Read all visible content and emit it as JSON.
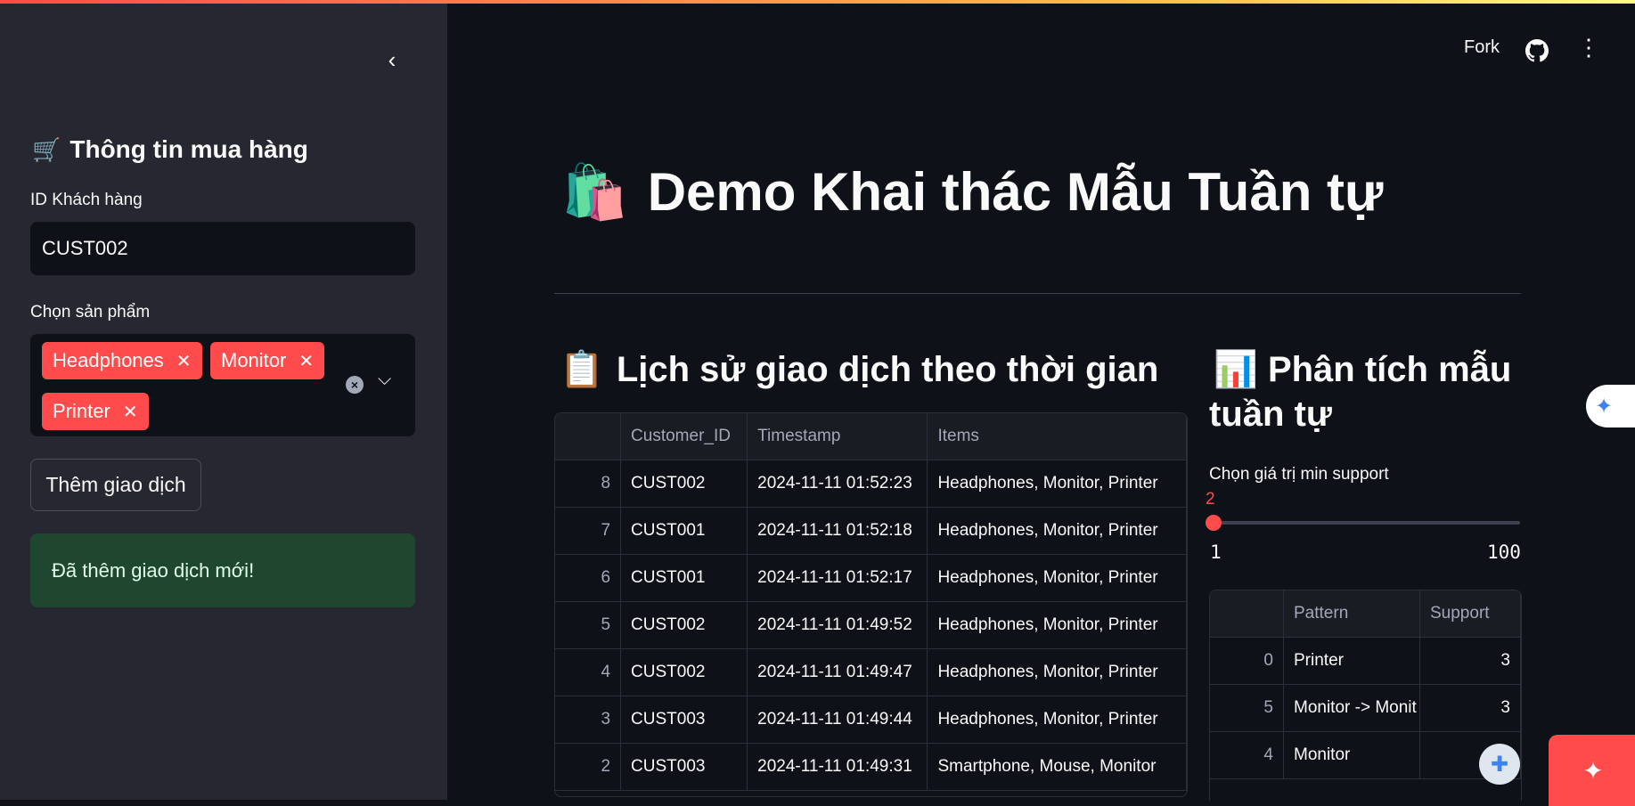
{
  "header": {
    "fork_label": "Fork",
    "github_icon": "github-icon",
    "menu_icon": "kebab-menu-icon"
  },
  "sidebar": {
    "collapse_icon": "chevron-left-icon",
    "title_icon": "🛒",
    "title": "Thông tin mua hàng",
    "customer_id_label": "ID Khách hàng",
    "customer_id_value": "CUST002",
    "products_label": "Chọn sản phẩm",
    "selected_products": [
      "Headphones",
      "Monitor",
      "Printer"
    ],
    "add_button": "Thêm giao dịch",
    "success_message": "Đã thêm giao dịch mới!"
  },
  "main": {
    "title_icon": "🛍️",
    "title": "Demo Khai thác Mẫu Tuần tự",
    "history": {
      "icon": "📋",
      "heading": "Lịch sử giao dịch theo thời gian",
      "columns": [
        "",
        "Customer_ID",
        "Timestamp",
        "Items"
      ],
      "rows": [
        [
          "8",
          "CUST002",
          "2024-11-11 01:52:23",
          "Headphones, Monitor, Printer"
        ],
        [
          "7",
          "CUST001",
          "2024-11-11 01:52:18",
          "Headphones, Monitor, Printer"
        ],
        [
          "6",
          "CUST001",
          "2024-11-11 01:52:17",
          "Headphones, Monitor, Printer"
        ],
        [
          "5",
          "CUST002",
          "2024-11-11 01:49:52",
          "Headphones, Monitor, Printer"
        ],
        [
          "4",
          "CUST002",
          "2024-11-11 01:49:47",
          "Headphones, Monitor, Printer"
        ],
        [
          "3",
          "CUST003",
          "2024-11-11 01:49:44",
          "Headphones, Monitor, Printer"
        ],
        [
          "2",
          "CUST003",
          "2024-11-11 01:49:31",
          "Smartphone, Mouse, Monitor"
        ]
      ]
    },
    "analysis": {
      "icon": "📊",
      "heading_line1": "Phân tích mẫu",
      "heading_line2": "tuần tự",
      "slider_label": "Chọn giá trị min support",
      "slider_value": "2",
      "slider_min": "1",
      "slider_max": "100",
      "slider_fraction": 0.0101,
      "columns": [
        "",
        "Pattern",
        "Support"
      ],
      "rows": [
        [
          "0",
          "Printer",
          "3"
        ],
        [
          "5",
          "Monitor -> Monit",
          "3"
        ],
        [
          "4",
          "Monitor",
          ""
        ]
      ]
    }
  },
  "colors": {
    "accent": "#ff4b4b",
    "sidebar_bg": "#262730",
    "main_bg": "#0e1117",
    "success_bg": "#1f4730"
  }
}
